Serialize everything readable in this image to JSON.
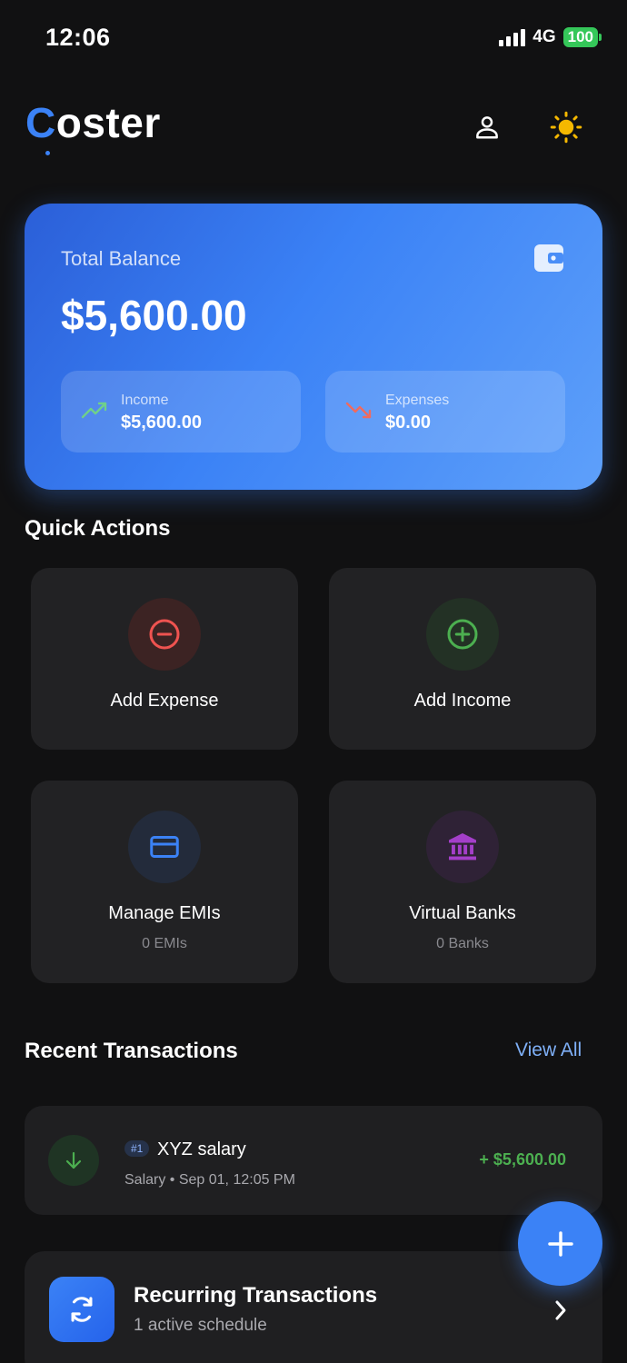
{
  "status_bar": {
    "time": "12:06",
    "network": "4G",
    "battery": "100"
  },
  "header": {
    "logo_first": "C",
    "logo_rest": "oster",
    "accent_color": "#3b82f6"
  },
  "balance_card": {
    "label": "Total Balance",
    "amount": "$5,600.00",
    "income_label": "Income",
    "income_value": "$5,600.00",
    "expenses_label": "Expenses",
    "expenses_value": "$0.00"
  },
  "quick_actions": {
    "title": "Quick Actions",
    "add_expense": "Add Expense",
    "add_income": "Add Income",
    "manage_emis": "Manage EMIs",
    "emis_count": "0 EMIs",
    "virtual_banks": "Virtual Banks",
    "banks_count": "0 Banks"
  },
  "recent_transactions": {
    "title": "Recent Transactions",
    "view_all": "View All",
    "items": [
      {
        "tag": "#1",
        "title": "XYZ salary",
        "meta": "Salary • Sep 01, 12:05 PM",
        "amount": "+ $5,600.00",
        "amount_color": "#4caf50"
      }
    ]
  },
  "recurring": {
    "title": "Recurring Transactions",
    "subtitle": "1 active schedule"
  },
  "icons": {
    "profile": "user-icon",
    "theme": "sun-icon",
    "wallet": "wallet-icon",
    "income": "trending-up-icon",
    "expense": "trending-down-icon",
    "add_expense": "minus-circle-icon",
    "add_income": "plus-circle-icon",
    "emis": "credit-card-icon",
    "banks": "bank-icon",
    "transaction": "arrow-down-icon",
    "recurring": "refresh-icon",
    "chevron": "chevron-right-icon",
    "fab": "plus-icon"
  }
}
